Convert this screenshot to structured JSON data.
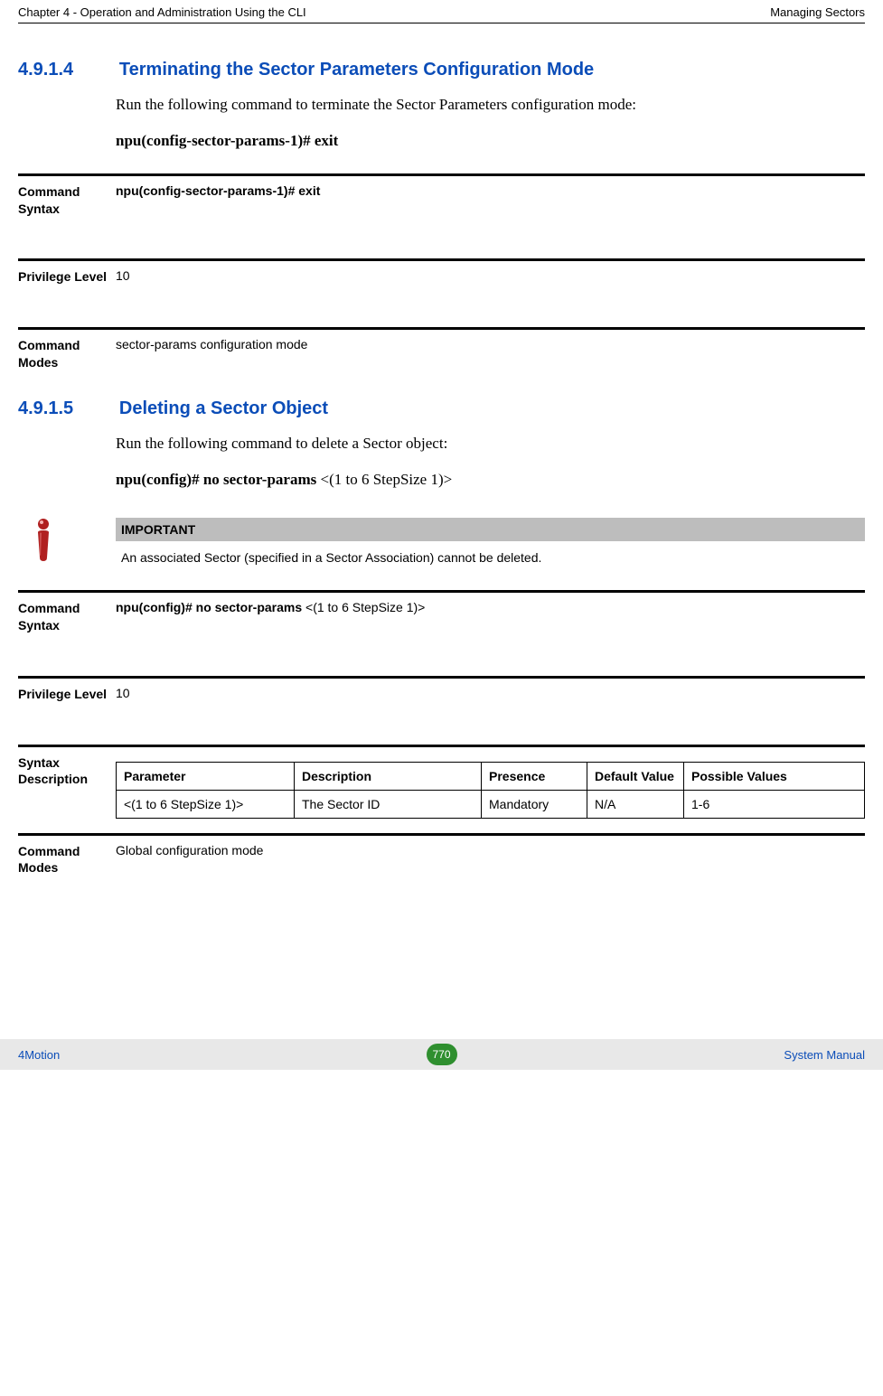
{
  "header": {
    "left": "Chapter 4 - Operation and Administration Using the CLI",
    "right": "Managing Sectors"
  },
  "s1": {
    "num": "4.9.1.4",
    "title": "Terminating the Sector Parameters Configuration Mode",
    "intro": "Run the following command to terminate the Sector Parameters configuration mode:",
    "command": "npu(config-sector-params-1)# exit",
    "defs": {
      "syntax_label": "Command Syntax",
      "syntax_value": "npu(config-sector-params-1)# exit",
      "priv_label": "Privilege Level",
      "priv_value": "10",
      "modes_label": "Command Modes",
      "modes_value": "sector-params configuration mode"
    }
  },
  "s2": {
    "num": "4.9.1.5",
    "title": "Deleting a Sector Object",
    "intro": "Run the following command to delete a Sector object:",
    "command_bold": "npu(config)# no sector-params",
    "command_arg": " <(1 to 6 StepSize 1)>",
    "important_title": "IMPORTANT",
    "important_text": "An associated Sector (specified in a Sector Association) cannot be deleted.",
    "defs": {
      "syntax_label": "Command Syntax",
      "syntax_bold": "npu(config)# no sector-params ",
      "syntax_arg": "<(1 to 6 StepSize 1)>",
      "priv_label": "Privilege Level",
      "priv_value": "10",
      "syntaxdesc_label": "Syntax Description",
      "modes_label": "Command Modes",
      "modes_value": "Global configuration mode"
    },
    "table": {
      "h1": "Parameter",
      "h2": "Description",
      "h3": "Presence",
      "h4": "Default Value",
      "h5": "Possible Values",
      "r1c1": " <(1 to 6 StepSize 1)>",
      "r1c2": "The Sector ID",
      "r1c3": "Mandatory",
      "r1c4": "N/A",
      "r1c5": "1-6"
    }
  },
  "footer": {
    "left": "4Motion",
    "page": "770",
    "right": "System Manual"
  }
}
